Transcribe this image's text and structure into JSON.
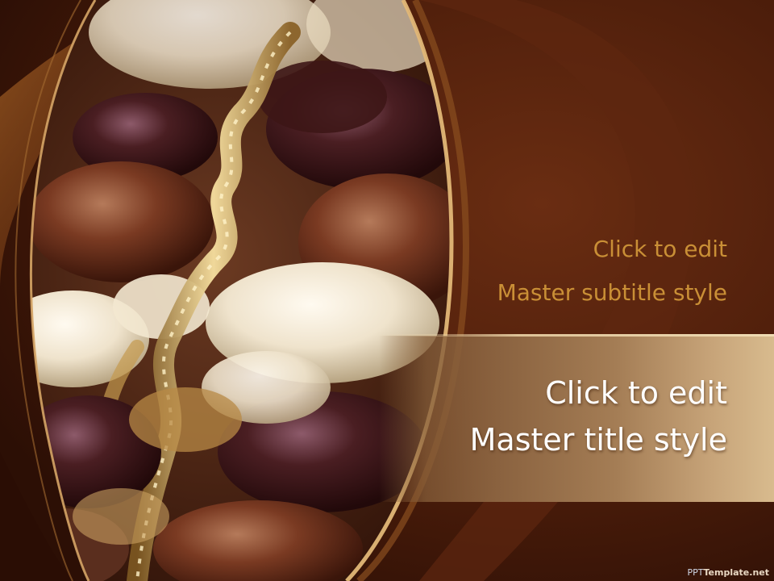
{
  "slide": {
    "subtitle_line1": "Click to edit",
    "subtitle_line2": "Master subtitle style",
    "title_line1": "Click to edit",
    "title_line2": "Master title style",
    "watermark_prefix": "PPT",
    "watermark_rest": "Template.net"
  },
  "theme": {
    "background": "#3a1508",
    "subtitle_color": "#c98f36",
    "title_color": "#ffffff",
    "accent_gold": "#d8bb8e"
  }
}
